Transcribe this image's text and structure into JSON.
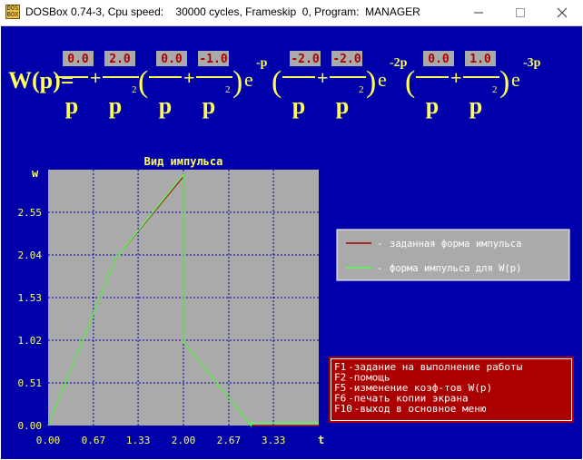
{
  "window": {
    "title": "DOSBox 0.74-3, Cpu speed:    30000 cycles, Frameskip  0, Program:  MANAGER",
    "icon_text": "DOS BOX",
    "controls": [
      "minimize-icon",
      "maximize-icon",
      "close-icon"
    ]
  },
  "formula": {
    "lhs": "W(p)=",
    "plus": "+",
    "open_paren": "(",
    "exp_base": "e",
    "denom_p": "p",
    "denom_2": "2",
    "groups": [
      {
        "coef_a": "0.0",
        "coef_b": "2.0",
        "exponent": ""
      },
      {
        "coef_a": "0.0",
        "coef_b": "-1.0",
        "exponent": "-p"
      },
      {
        "coef_a": "-2.0",
        "coef_b": "-2.0",
        "exponent": "-2p"
      },
      {
        "coef_a": "0.0",
        "coef_b": "1.0",
        "exponent": "-3p"
      }
    ]
  },
  "chart_data": {
    "type": "line",
    "title": "Вид импульса",
    "ylabel": "w",
    "xlabel": "t",
    "xlim": [
      0,
      4.0
    ],
    "ylim": [
      0,
      3.06
    ],
    "x_ticks": [
      "0.00",
      "0.67",
      "1.33",
      "2.00",
      "2.67",
      "3.33"
    ],
    "y_ticks": [
      "0.00",
      "0.51",
      "1.02",
      "1.53",
      "2.04",
      "2.55"
    ],
    "grid": true,
    "series": [
      {
        "name": "заданная форма импульса",
        "color": "#aa0000",
        "x": [
          0,
          1.0,
          2.0,
          2.0,
          3.0,
          4.0
        ],
        "y": [
          0,
          2.0,
          2.98,
          1.0,
          0.0,
          0.0
        ]
      },
      {
        "name": "форма импульса для W(p)",
        "color": "#55ff55",
        "x": [
          0,
          1.0,
          2.0,
          2.0,
          3.0,
          3.0,
          4.0
        ],
        "y": [
          0,
          2.0,
          3.0,
          1.0,
          0.0,
          0.03,
          0.03
        ]
      }
    ]
  },
  "legend": {
    "items": [
      {
        "dash": "-",
        "label": "заданная форма импульса",
        "color": "#aa0000"
      },
      {
        "dash": "-",
        "label": "форма импульса для W(p)",
        "color": "#55ff55"
      }
    ]
  },
  "menu": {
    "items": [
      {
        "key": "F1",
        "text": "-задание на выполнение работы"
      },
      {
        "key": "F2",
        "text": "-помощь"
      },
      {
        "key": "F5",
        "text": "-изменение коэф-тов W(p)"
      },
      {
        "key": "F6",
        "text": "-печать копии экрана"
      },
      {
        "key": "F10",
        "text": "-выход в основное меню"
      }
    ]
  },
  "colors": {
    "dos_blue": "#0000aa",
    "yellow": "#ffff55",
    "coef_box": "#aaaaaa",
    "coef_text": "#aa0000",
    "plot_bg": "#aaaaaa",
    "grid": "#0000aa",
    "menu_bg": "#aa0000",
    "menu_text": "#ffffff"
  }
}
